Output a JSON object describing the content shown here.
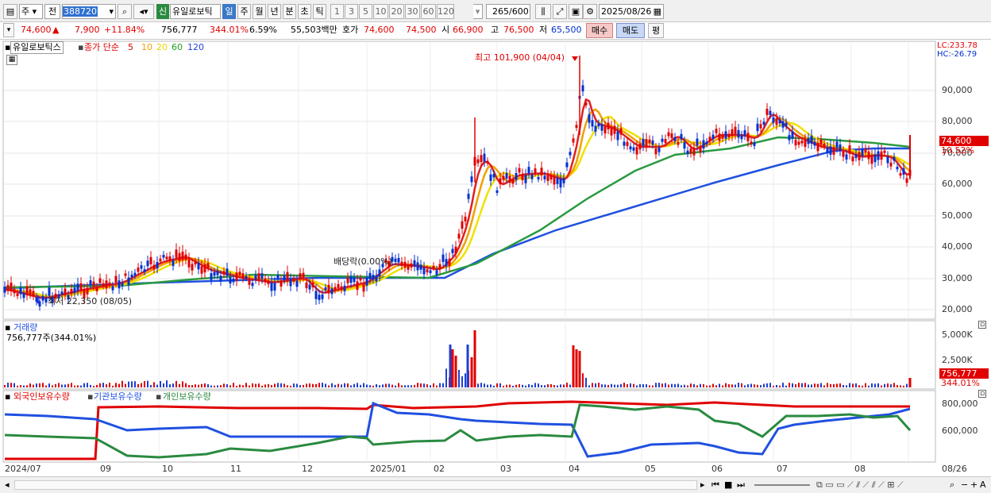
{
  "toolbar": {
    "period_type": "주",
    "range_type": "전",
    "stock_code": "388720",
    "new_badge": "신",
    "stock_name": "유일로보틱",
    "tabs": [
      "일",
      "주",
      "월",
      "년",
      "분",
      "초",
      "틱"
    ],
    "active_tab": "일",
    "intervals": [
      "1",
      "3",
      "5",
      "10",
      "20",
      "30",
      "60",
      "120"
    ],
    "count_value": "265",
    "count_total": "/600",
    "date": "2025/08/26"
  },
  "quote": {
    "price": "74,600",
    "change": "7,900",
    "change_pct": "+11.84%",
    "volume": "756,777",
    "volume_ratio": "344.01%",
    "turnover_pct": "6.59%",
    "amount": "55,503백만",
    "bid_label": "호가",
    "ask_price": "74,600",
    "bid_price": "74,500",
    "open_label": "시",
    "open": "66,900",
    "high_label": "고",
    "high": "76,500",
    "low_label": "저",
    "low": "65,500",
    "buy_button": "매수",
    "sell_button": "매도",
    "eval_button": "평"
  },
  "price_panel": {
    "legend_name": "유일로보틱스",
    "legend_ma_label": "종가 단순",
    "ma_periods": [
      "5",
      "10",
      "20",
      "60",
      "120"
    ],
    "ma_colors": [
      "#e00000",
      "#f0a000",
      "#f0e000",
      "#20a020",
      "#2040e0"
    ],
    "lc": "LC:233.78",
    "hc": "HC:-26.79",
    "high_note": "최고 101,900 (04/04)",
    "low_note": "최저 22,350 (08/05)",
    "dividend_note": "배당락(0.00%)",
    "price_tag": "74,600",
    "pct_tag": "10.52%",
    "y_ticks": [
      "90,000",
      "80,000",
      "70,000",
      "60,000",
      "50,000",
      "40,000",
      "30,000",
      "20,000"
    ]
  },
  "volume_panel": {
    "title": "거래량",
    "value_text": "756,777주(344.01%)",
    "y_ticks": [
      "5,000K",
      "2,500K"
    ],
    "vol_tag": "756,777",
    "pct_tag": "344.01%"
  },
  "holdings_panel": {
    "legend": [
      "외국인보유수량",
      "기관보유수량",
      "개인보유수량"
    ],
    "colors": [
      "#e00000",
      "#2050e0",
      "#2a8a40"
    ],
    "y_ticks": [
      "800,000",
      "600,000"
    ]
  },
  "x_axis": {
    "labels": [
      "2024/07",
      "09",
      "10",
      "11",
      "12",
      "2025/01",
      "02",
      "03",
      "04",
      "05",
      "06",
      "07",
      "08",
      "08/26"
    ]
  }
}
